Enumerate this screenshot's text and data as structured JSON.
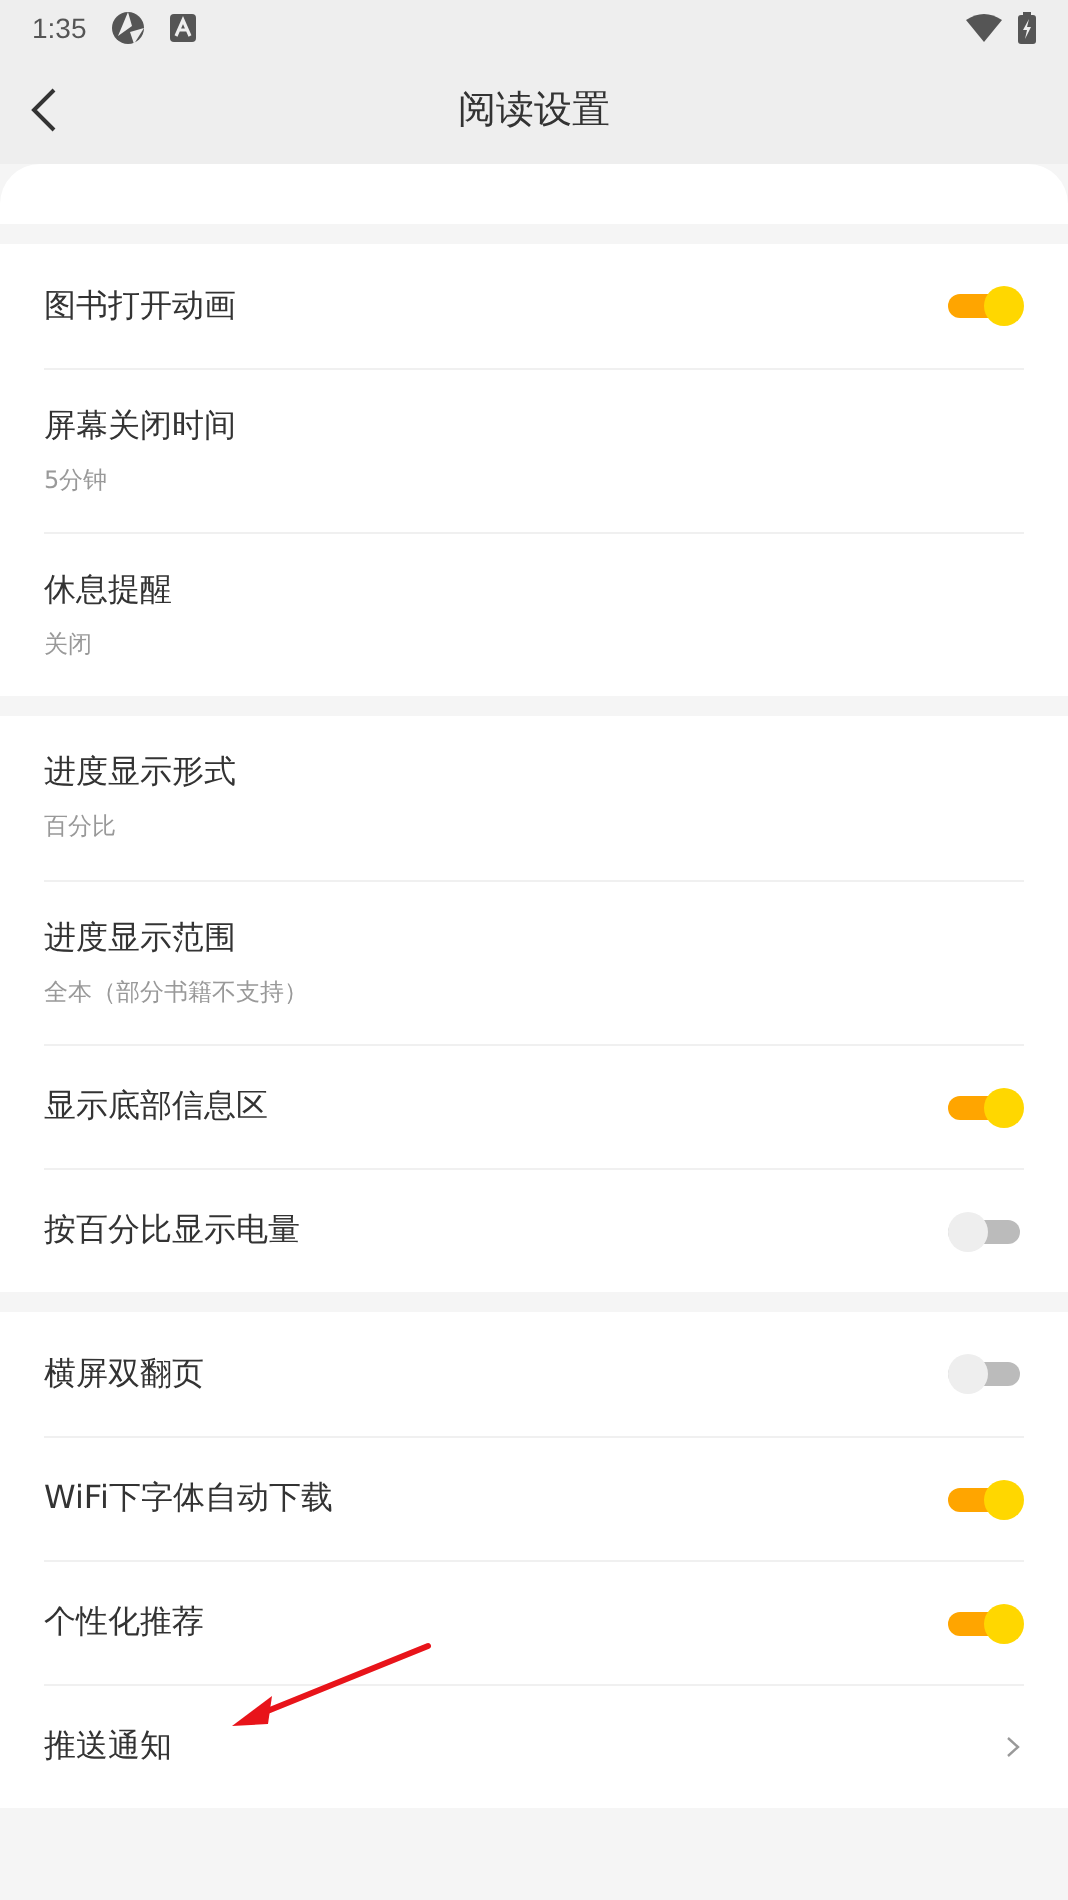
{
  "status_bar": {
    "time": "1:35"
  },
  "header": {
    "title": "阅读设置"
  },
  "sections": [
    {
      "rows": [
        {
          "kind": "toggle",
          "label": "图书打开动画",
          "on": true
        },
        {
          "kind": "value",
          "label": "屏幕关闭时间",
          "value": "5分钟"
        },
        {
          "kind": "value",
          "label": "休息提醒",
          "value": "关闭"
        }
      ]
    },
    {
      "rows": [
        {
          "kind": "value",
          "label": "进度显示形式",
          "value": "百分比"
        },
        {
          "kind": "value",
          "label": "进度显示范围",
          "value": "全本（部分书籍不支持）"
        },
        {
          "kind": "toggle",
          "label": "显示底部信息区",
          "on": true
        },
        {
          "kind": "toggle",
          "label": "按百分比显示电量",
          "on": false
        }
      ]
    },
    {
      "rows": [
        {
          "kind": "toggle",
          "label": "横屏双翻页",
          "on": false
        },
        {
          "kind": "toggle",
          "label": "WiFi下字体自动下载",
          "on": true
        },
        {
          "kind": "toggle",
          "label": "个性化推荐",
          "on": true
        },
        {
          "kind": "link",
          "label": "推送通知"
        }
      ]
    }
  ]
}
